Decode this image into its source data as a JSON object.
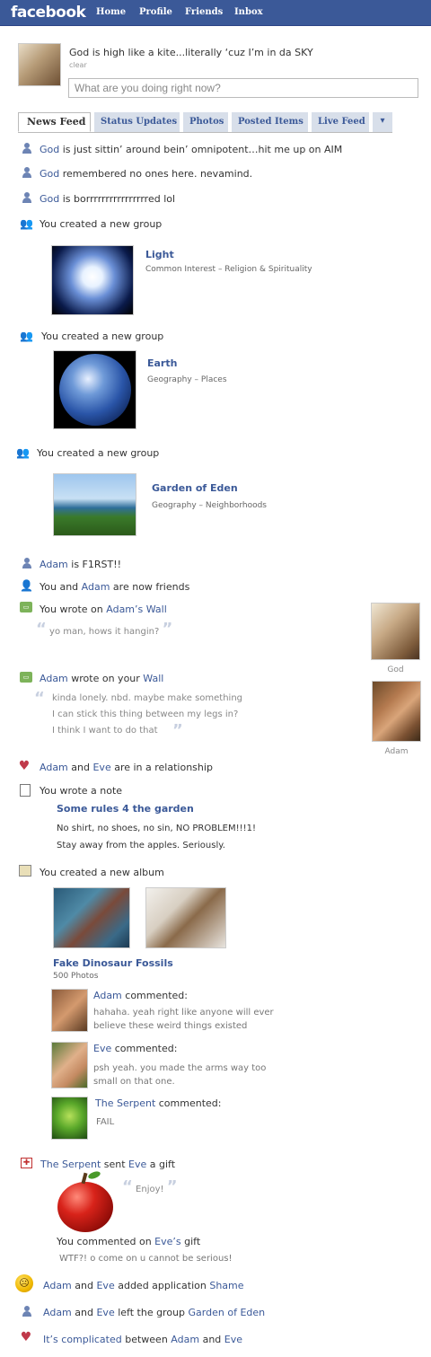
{
  "header": {
    "logo": "facebook",
    "nav": [
      "Home",
      "Profile",
      "Friends",
      "Inbox"
    ]
  },
  "profile": {
    "status": "God is high like a kite...literally ‘cuz I’m in da SKY",
    "clear": "clear",
    "placeholder": "What are you doing right now?"
  },
  "tabs": [
    "News Feed",
    "Status Updates",
    "Photos",
    "Posted Items",
    "Live Feed"
  ],
  "feed": {
    "s1_name": "God",
    "s1_text": " is just sittin’ around bein’ omnipotent…hit me up on AIM",
    "s2_name": "God",
    "s2_text": " remembered no ones here. nevamind.",
    "s3_name": "God",
    "s3_text": " is borrrrrrrrrrrrrrrred lol",
    "g1_text": "You created a new group",
    "g1_title": "Light",
    "g1_sub": "Common Interest – Religion & Spirituality",
    "g2_text": "You created a new group",
    "g2_title": "Earth",
    "g2_sub": "Geography – Places",
    "g3_text": "You created a new group",
    "g3_title": "Garden of Eden",
    "g3_sub": "Geography – Neighborhoods",
    "adam_first_name": "Adam",
    "adam_first_text": " is F1RST!!",
    "friends_a": "You and ",
    "friends_name": "Adam",
    "friends_b": " are now friends",
    "wall1_a": "You wrote on ",
    "wall1_name": "Adam’s Wall",
    "wall1_quote": "yo man, hows it hangin?",
    "god_caption": "God",
    "wall2_name": "Adam",
    "wall2_a": " wrote on your ",
    "wall2_wall": "Wall",
    "wall2_l1": "kinda lonely. nbd. maybe make something",
    "wall2_l2": "I can stick this thing between my legs in?",
    "wall2_l3": "I think I want to do that",
    "adam_caption": "Adam",
    "rel_adam": "Adam",
    "rel_and": " and ",
    "rel_eve": "Eve",
    "rel_text": " are in a relationship",
    "note_text": "You wrote a note",
    "note_title": "Some rules 4 the garden",
    "note_l1": "No shirt, no shoes, no sin, NO PROBLEM!!!1!",
    "note_l2": "Stay away from the apples. Seriously.",
    "album_text": "You created a new album",
    "album_title": "Fake Dinosaur Fossils",
    "album_sub": "500 Photos",
    "c1_name": "Adam",
    "c1_label": " commented:",
    "c1_l1": "hahaha. yeah right like anyone will ever",
    "c1_l2": "believe these weird things existed",
    "c2_name": "Eve",
    "c2_label": " commented:",
    "c2_l1": "psh yeah. you made the arms way too",
    "c2_l2": "small on that one.",
    "c3_name": "The Serpent",
    "c3_label": " commented:",
    "c3_l1": "FAIL",
    "gift_serpent": "The Serpent",
    "gift_a": " sent ",
    "gift_eve": "Eve",
    "gift_b": " a gift",
    "gift_quote": "Enjoy!",
    "gc_a": "You commented on ",
    "gc_eve": "Eve’s",
    "gc_b": " gift",
    "gc_text": "WTF?! o come on u cannot be serious!",
    "app_adam": "Adam",
    "app_and": " and ",
    "app_eve": "Eve",
    "app_a": " added application ",
    "app_name": "Shame",
    "left_adam": "Adam",
    "left_and": " and ",
    "left_eve": "Eve",
    "left_a": " left the group ",
    "left_group": "Garden of Eden",
    "comp_a": "It’s complicated",
    "comp_b": " between ",
    "comp_adam": "Adam",
    "comp_and": " and ",
    "comp_eve": "Eve"
  },
  "colors": {
    "brand": "#3b5998",
    "link": "#3b5998",
    "tab_bg": "#d8dfea"
  }
}
